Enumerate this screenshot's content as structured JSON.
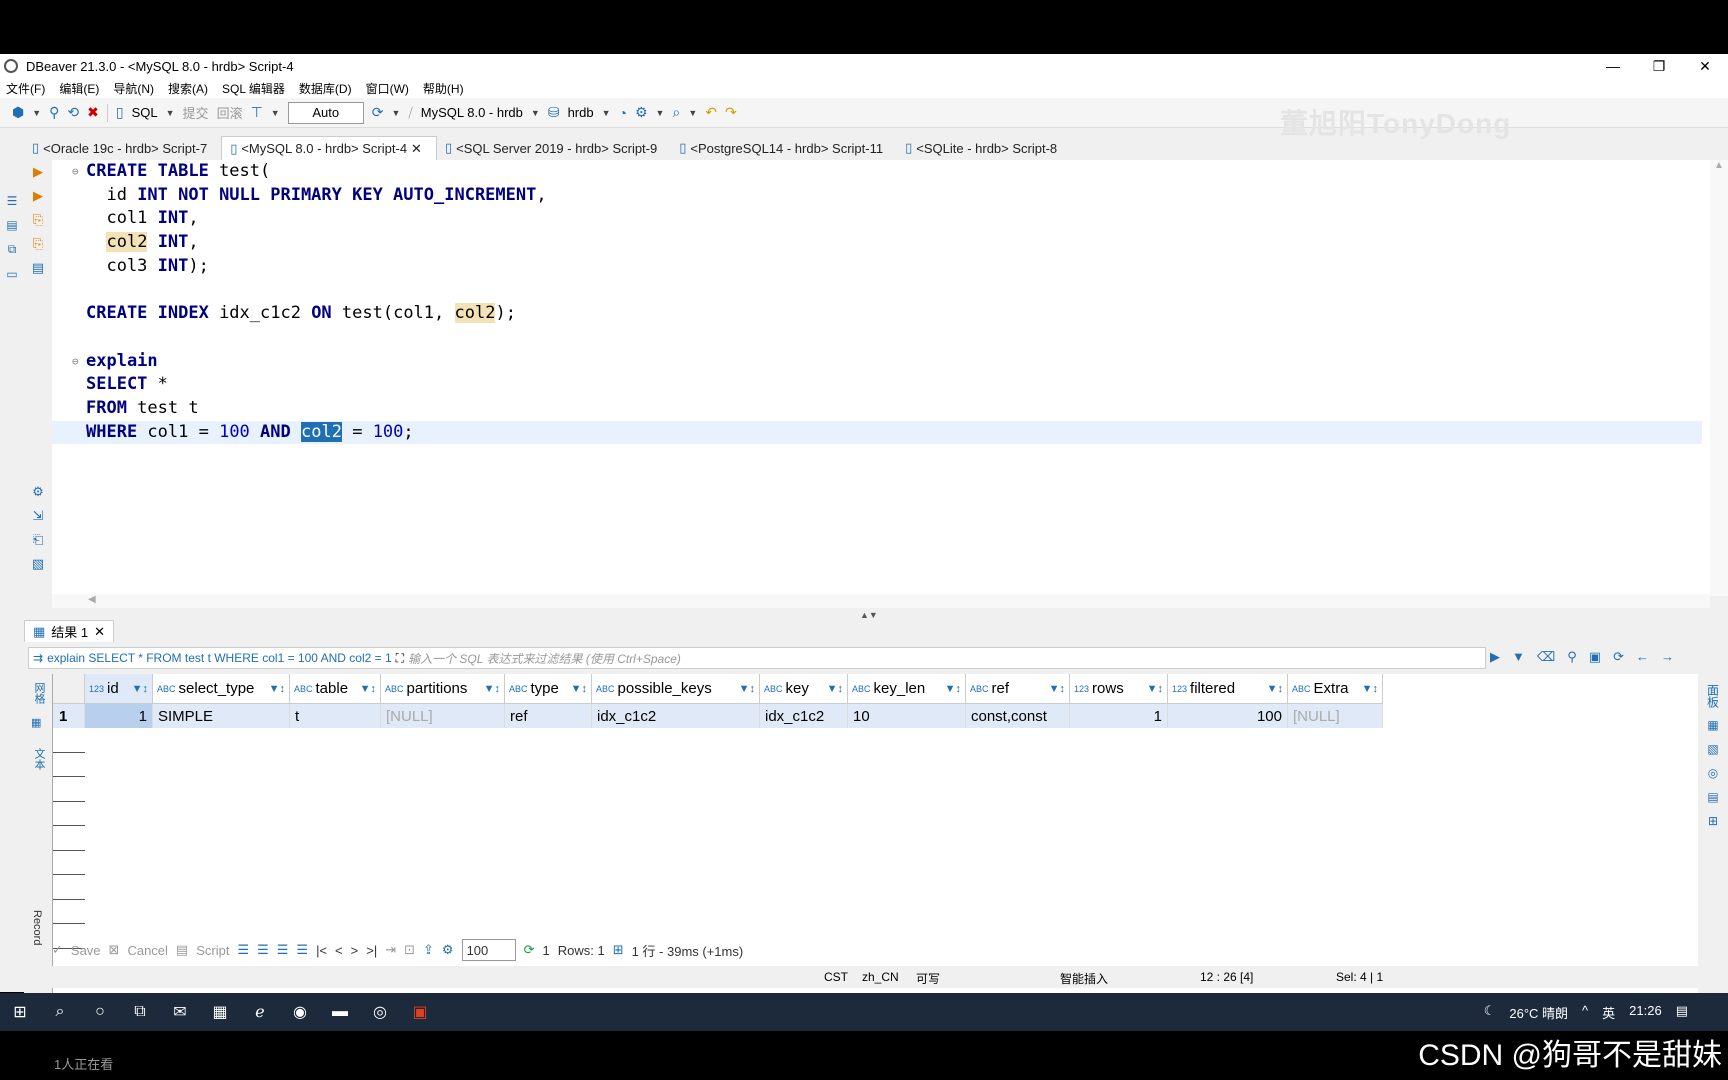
{
  "window": {
    "title": "DBeaver 21.3.0 - <MySQL 8.0 - hrdb> Script-4"
  },
  "menu": [
    "文件(F)",
    "编辑(E)",
    "导航(N)",
    "搜索(A)",
    "SQL 编辑器",
    "数据库(D)",
    "窗口(W)",
    "帮助(H)"
  ],
  "toolbar": {
    "sql_label": "SQL",
    "commit_label": "提交",
    "rollback_label": "回滚",
    "mode": "Auto",
    "connection": "MySQL 8.0 - hrdb",
    "schema": "hrdb"
  },
  "watermark": "董旭阳TonyDong",
  "tabs": [
    {
      "label": "<Oracle 19c - hrdb> Script-7"
    },
    {
      "label": "<MySQL 8.0 - hrdb> Script-4",
      "active": true
    },
    {
      "label": "<SQL Server 2019 - hrdb> Script-9"
    },
    {
      "label": "<PostgreSQL14 - hrdb> Script-11"
    },
    {
      "label": "<SQLite - hrdb> Script-8"
    }
  ],
  "editor": {
    "cursor_line": 12
  },
  "results": {
    "tab_label": "结果 1",
    "query": "explain SELECT * FROM test t WHERE col1 = 100 AND col2 = 1",
    "filter_placeholder": "输入一个 SQL 表达式来过滤结果 (使用 Ctrl+Space)",
    "side_grid_label": "网格",
    "side_text_label": "文本",
    "side_record_label": "Record",
    "right_panel_label": "面板",
    "columns": [
      {
        "name": "id",
        "type": "123"
      },
      {
        "name": "select_type",
        "type": "ABC"
      },
      {
        "name": "table",
        "type": "ABC"
      },
      {
        "name": "partitions",
        "type": "ABC"
      },
      {
        "name": "type",
        "type": "ABC"
      },
      {
        "name": "possible_keys",
        "type": "ABC"
      },
      {
        "name": "key",
        "type": "ABC"
      },
      {
        "name": "key_len",
        "type": "ABC"
      },
      {
        "name": "ref",
        "type": "ABC"
      },
      {
        "name": "rows",
        "type": "123"
      },
      {
        "name": "filtered",
        "type": "123"
      },
      {
        "name": "Extra",
        "type": "ABC"
      }
    ],
    "row_number": "1",
    "row": [
      "1",
      "SIMPLE",
      "t",
      "[NULL]",
      "ref",
      "idx_c1c2",
      "idx_c1c2",
      "10",
      "const,const",
      "1",
      "100",
      "[NULL]"
    ]
  },
  "bottom": {
    "save": "Save",
    "cancel": "Cancel",
    "script": "Script",
    "limit": "100",
    "fetched": "1",
    "rows": "Rows: 1",
    "timing": "1 行 - 39ms (+1ms)"
  },
  "status": {
    "tz": "CST",
    "locale": "zh_CN",
    "mode": "可写",
    "insert": "智能插入",
    "pos": "12 : 26 [4]",
    "sel": "Sel: 4 | 1"
  },
  "taskbar": {
    "weather": "26°C 晴朗",
    "ime": "英",
    "time": "21:26"
  },
  "overlay": {
    "watching": "1人正在看",
    "csdn": "CSDN @狗哥不是甜妹"
  }
}
